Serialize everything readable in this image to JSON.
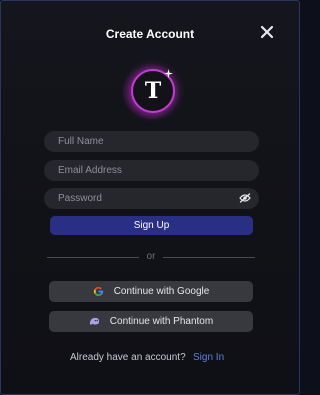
{
  "modal": {
    "title": "Create Account",
    "logo_letter": "T"
  },
  "form": {
    "full_name_placeholder": "Full Name",
    "email_placeholder": "Email Address",
    "password_placeholder": "Password",
    "sign_up_label": "Sign Up"
  },
  "divider": {
    "label": "or"
  },
  "social": {
    "google_label": "Continue with Google",
    "phantom_label": "Continue with Phantom"
  },
  "footer": {
    "question": "Already have an account?",
    "sign_in_label": "Sign In"
  },
  "colors": {
    "accent": "#2a2f86",
    "link": "#5f7ee8",
    "logo_glow": "#c23bd6"
  },
  "icons": {
    "close": "close-icon",
    "password_toggle": "eye-off-icon",
    "google": "google-icon",
    "phantom": "phantom-icon",
    "sparkle": "sparkle-icon"
  }
}
